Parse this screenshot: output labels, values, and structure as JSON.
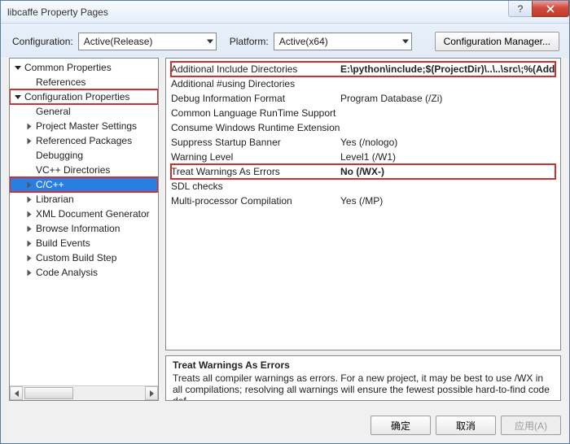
{
  "window": {
    "title": "libcaffe Property Pages"
  },
  "toolbar": {
    "configuration_label": "Configuration:",
    "configuration_value": "Active(Release)",
    "platform_label": "Platform:",
    "platform_value": "Active(x64)",
    "manager_label": "Configuration Manager..."
  },
  "tree": {
    "items": [
      {
        "label": "Common Properties",
        "depth": 0,
        "expanded": true,
        "hasChildren": true
      },
      {
        "label": "References",
        "depth": 1,
        "expanded": false,
        "hasChildren": false
      },
      {
        "label": "Configuration Properties",
        "depth": 0,
        "expanded": true,
        "hasChildren": true,
        "redbox": true
      },
      {
        "label": "General",
        "depth": 1,
        "expanded": false,
        "hasChildren": false
      },
      {
        "label": "Project Master Settings",
        "depth": 1,
        "expanded": false,
        "hasChildren": true
      },
      {
        "label": "Referenced Packages",
        "depth": 1,
        "expanded": false,
        "hasChildren": true
      },
      {
        "label": "Debugging",
        "depth": 1,
        "expanded": false,
        "hasChildren": false
      },
      {
        "label": "VC++ Directories",
        "depth": 1,
        "expanded": false,
        "hasChildren": false
      },
      {
        "label": "C/C++",
        "depth": 1,
        "expanded": false,
        "hasChildren": true,
        "selected": true,
        "redbox": true
      },
      {
        "label": "Librarian",
        "depth": 1,
        "expanded": false,
        "hasChildren": true
      },
      {
        "label": "XML Document Generator",
        "depth": 1,
        "expanded": false,
        "hasChildren": true
      },
      {
        "label": "Browse Information",
        "depth": 1,
        "expanded": false,
        "hasChildren": true
      },
      {
        "label": "Build Events",
        "depth": 1,
        "expanded": false,
        "hasChildren": true
      },
      {
        "label": "Custom Build Step",
        "depth": 1,
        "expanded": false,
        "hasChildren": true
      },
      {
        "label": "Code Analysis",
        "depth": 1,
        "expanded": false,
        "hasChildren": true
      }
    ]
  },
  "grid": {
    "rows": [
      {
        "name": "Additional Include Directories",
        "value": "E:\\python\\include;$(ProjectDir)\\..\\..\\src\\;%(AdditionalIncludeDirectories)",
        "bold": true,
        "redbox": true
      },
      {
        "name": "Additional #using Directories",
        "value": ""
      },
      {
        "name": "Debug Information Format",
        "value": "Program Database (/Zi)"
      },
      {
        "name": "Common Language RunTime Support",
        "value": ""
      },
      {
        "name": "Consume Windows Runtime Extension",
        "value": ""
      },
      {
        "name": "Suppress Startup Banner",
        "value": "Yes (/nologo)"
      },
      {
        "name": "Warning Level",
        "value": "Level1 (/W1)"
      },
      {
        "name": "Treat Warnings As Errors",
        "value": "No (/WX-)",
        "bold": true,
        "redbox": true
      },
      {
        "name": "SDL checks",
        "value": ""
      },
      {
        "name": "Multi-processor Compilation",
        "value": "Yes (/MP)"
      }
    ]
  },
  "help": {
    "title": "Treat Warnings As Errors",
    "body": "Treats all compiler warnings as errors. For a new project, it may be best to use /WX in all compilations; resolving all warnings will ensure the fewest possible hard-to-find code def..."
  },
  "buttons": {
    "ok": "确定",
    "cancel": "取消",
    "apply": "应用(A)"
  }
}
